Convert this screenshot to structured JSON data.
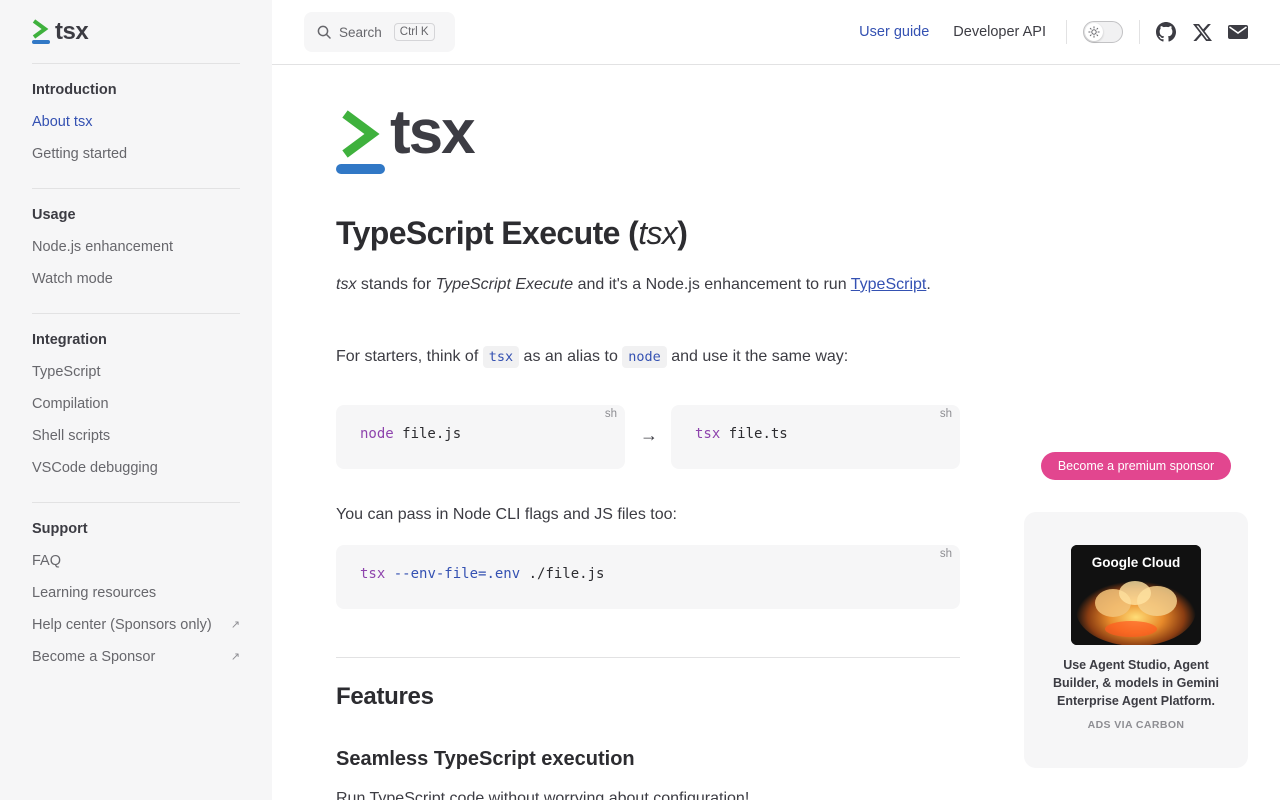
{
  "brand": {
    "name": "tsx"
  },
  "sidebar": {
    "groups": [
      {
        "title": "Introduction",
        "items": [
          {
            "label": "About tsx"
          },
          {
            "label": "Getting started"
          }
        ]
      },
      {
        "title": "Usage",
        "items": [
          {
            "label": "Node.js enhancement"
          },
          {
            "label": "Watch mode"
          }
        ]
      },
      {
        "title": "Integration",
        "items": [
          {
            "label": "TypeScript"
          },
          {
            "label": "Compilation"
          },
          {
            "label": "Shell scripts"
          },
          {
            "label": "VSCode debugging"
          }
        ]
      },
      {
        "title": "Support",
        "items": [
          {
            "label": "FAQ"
          },
          {
            "label": "Learning resources"
          },
          {
            "label": "Help center (Sponsors only)",
            "external": "↗"
          },
          {
            "label": "Become a Sponsor",
            "external": "↗"
          }
        ]
      }
    ]
  },
  "header": {
    "search_label": "Search",
    "search_shortcut": "Ctrl K",
    "nav": [
      {
        "label": "User guide"
      },
      {
        "label": "Developer API"
      }
    ],
    "social_icons": [
      "github-icon",
      "x-icon",
      "mail-icon"
    ]
  },
  "main": {
    "hero_word": "tsx",
    "title_main": "TypeScript Execute (",
    "title_em": "tsx",
    "title_close": ")",
    "intro": {
      "em1": "tsx",
      "t1": " stands for ",
      "em2": "TypeScript Execute",
      "t2": " and it's a Node.js enhancement to run ",
      "link": "TypeScript",
      "t3": "."
    },
    "alias": {
      "t1": "For starters, think of ",
      "code1": "tsx",
      "t2": " as an alias to ",
      "code2": "node",
      "t3": " and use it the same way:"
    },
    "code_left": {
      "lang": "sh",
      "cmd": "node",
      "arg": " file.js"
    },
    "arrow": "→",
    "code_right": {
      "lang": "sh",
      "cmd": "tsx",
      "arg": " file.ts"
    },
    "pass_text": "You can pass in Node CLI flags and JS files too:",
    "code_flags": {
      "lang": "sh",
      "cmd": "tsx",
      "flag": " --env-file=.env",
      "arg": " ./file.js"
    },
    "features_heading": "Features",
    "seamless_heading": "Seamless TypeScript execution",
    "cutoff_text": "Run TypeScript code without worrying about configuration!"
  },
  "sponsor": {
    "button_label": "Become a premium sponsor",
    "ad_brand": "Google Cloud",
    "ad_text": "Use Agent Studio, Agent Builder, & models in Gemini Enterprise Agent Platform.",
    "ad_via": "ADS VIA CARBON"
  },
  "colors": {
    "accent": "#3451b2",
    "brand_green": "#3fb13d",
    "brand_blue": "#3178c6",
    "sponsor_pink": "#e2468f"
  }
}
